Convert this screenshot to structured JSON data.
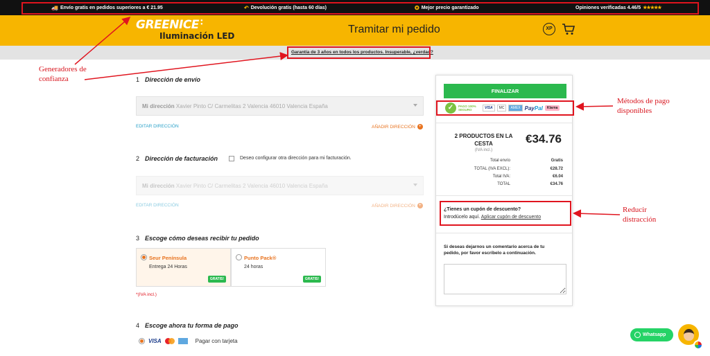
{
  "topbar": {
    "items": [
      {
        "icon": "truck-icon",
        "text": "Envío gratis en pedidos superiores a € 21.95"
      },
      {
        "icon": "return-icon",
        "text": "Devolución gratis (hasta 60 días)"
      },
      {
        "icon": "badge-icon",
        "text": "Mejor precio garantizado"
      },
      {
        "icon": "star-icon",
        "text": "Opiniones verificadas 4.46/5"
      }
    ],
    "stars": "★★★★★"
  },
  "header": {
    "logo_top": "GREENICE",
    "logo_bottom": "Iluminación LED",
    "title": "Tramitar mi pedido",
    "xp": "XP"
  },
  "guarantee_link": "Garantía de 3 años en todos los productos. Insuperable, ¿verdad?",
  "annotations": {
    "trust": "Generadores de confianza",
    "payment": "Métodos de pago disponibles",
    "distraction": "Reducir distracción"
  },
  "shipping_address": {
    "number": "1",
    "title": "Dirección de envío",
    "select_label": "Mi dirección",
    "select_value": "Xavier Pinto C/ Carmelitas 2 Valencia 46010 Valencia España",
    "edit": "EDITAR DIRECCIÓN",
    "add": "AÑADIR DIRECCIÓN"
  },
  "billing_address": {
    "number": "2",
    "title": "Dirección de facturación",
    "checkbox_label": "Deseo configurar otra dirección para mi facturación.",
    "select_label": "Mi dirección",
    "select_value": "Xavier Pinto C/ Carmelitas 2 Valencia 46010 Valencia España",
    "edit": "EDITAR DIRECCIÓN",
    "add": "AÑADIR DIRECCIÓN"
  },
  "delivery": {
    "number": "3",
    "title": "Escoge cómo deseas recibir tu pedido",
    "options": [
      {
        "name": "Seur Península",
        "detail": "Entrega 24 Horas",
        "badge": "GRATIS!",
        "selected": true
      },
      {
        "name": "Punto Pack®",
        "detail": "24 horas",
        "badge": "GRATIS!",
        "selected": false
      }
    ],
    "iva_note": "*(IVA incl.)"
  },
  "payment": {
    "number": "4",
    "title": "Escoge ahora tu forma de pago",
    "options": [
      {
        "brand": "VISA",
        "label": "Pagar con tarjeta",
        "selected": true
      }
    ]
  },
  "summary": {
    "finalize": "FINALIZAR",
    "secure_text": "PAGO 100% SEGURO",
    "logos": [
      "VISA",
      "MC",
      "AMEX"
    ],
    "paypal_a": "Pay",
    "paypal_b": "Pal",
    "klarna": "Klarna",
    "count": "2 PRODUCTOS EN LA CESTA",
    "iva_incl": "(IVA incl.)",
    "total": "€34.76",
    "rows": [
      {
        "label": "Total envío",
        "value": "Gratis"
      },
      {
        "label": "TOTAL  (IVA EXCL):",
        "value": "€28.72"
      },
      {
        "label": "Total IVA:",
        "value": "€6.04"
      },
      {
        "label": "TOTAL",
        "value": "€34.76"
      }
    ],
    "coupon_question": "¿Tienes un cupón de descuento?",
    "coupon_intro": "Introdúcelo aquí.",
    "coupon_link": "Aplicar cupón de descuento",
    "comment_text": "Si deseas dejarnos un comentario acerca de tu pedido, por favor escríbelo a continuación."
  },
  "whatsapp": "Whatsapp"
}
